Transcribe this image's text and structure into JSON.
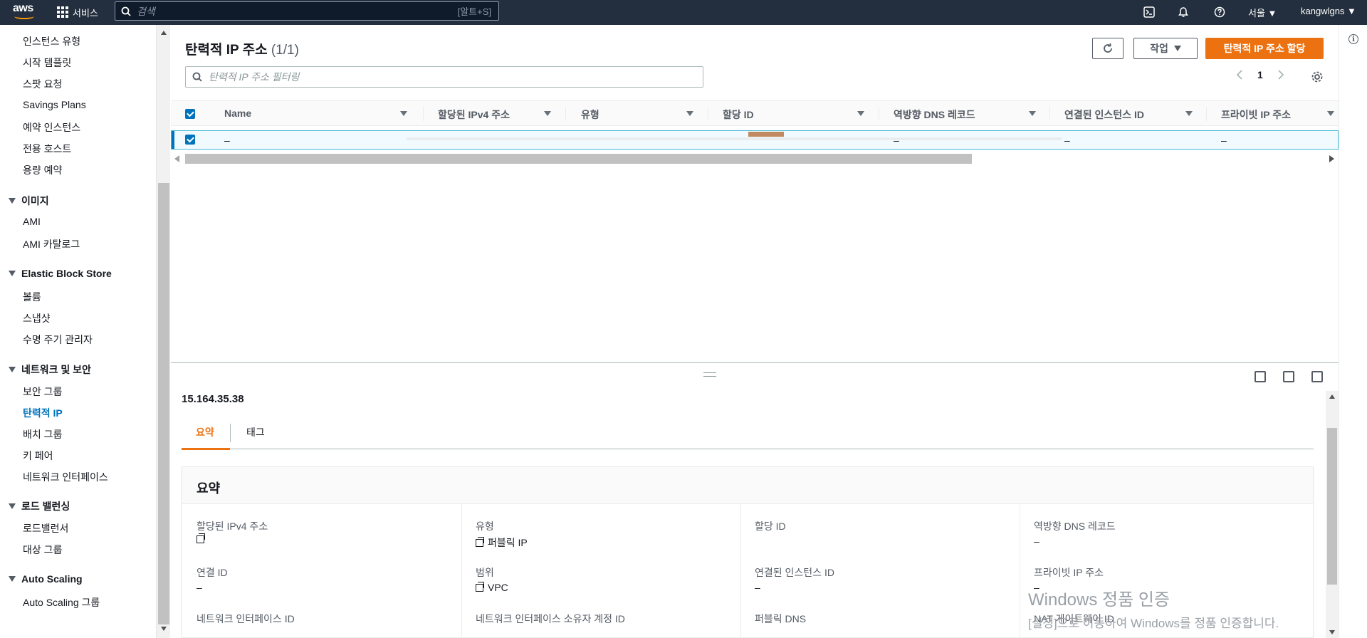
{
  "topnav": {
    "logo_text": "aws",
    "services_label": "서비스",
    "search_placeholder": "검색",
    "search_shortcut": "[알트+S]",
    "region": "서울 ▼",
    "account": "kangwlgns ▼"
  },
  "sidebar": {
    "items_top": [
      "인스턴스 유형",
      "시작 템플릿",
      "스팟 요청",
      "Savings Plans",
      "예약 인스턴스",
      "전용 호스트",
      "용량 예약"
    ],
    "section_images": {
      "title": "이미지",
      "items": [
        "AMI",
        "AMI 카탈로그"
      ]
    },
    "section_ebs": {
      "title": "Elastic Block Store",
      "items": [
        "볼륨",
        "스냅샷",
        "수명 주기 관리자"
      ]
    },
    "section_network": {
      "title": "네트워크 및 보안",
      "items": [
        "보안 그룹",
        "탄력적 IP",
        "배치 그룹",
        "키 페어",
        "네트워크 인터페이스"
      ],
      "active": "탄력적 IP"
    },
    "section_lb": {
      "title": "로드 밸런싱",
      "items": [
        "로드밸런서",
        "대상 그룹"
      ]
    },
    "section_as": {
      "title": "Auto Scaling",
      "items": [
        "Auto Scaling 그룹"
      ]
    }
  },
  "main": {
    "title": "탄력적 IP 주소",
    "count": "(1/1)",
    "actions_label": "작업",
    "allocate_label": "탄력적 IP 주소 할당",
    "filter_placeholder": "탄력적 IP 주소 필터링",
    "page_number": "1"
  },
  "table": {
    "columns": [
      "Name",
      "할당된 IPv4 주소",
      "유형",
      "할당 ID",
      "역방향 DNS 레코드",
      "연결된 인스턴스 ID",
      "프라이빗 IP 주소"
    ],
    "rows": [
      {
        "name": "–",
        "ipv4": "",
        "type": "",
        "allocation_id": "",
        "reverse_dns": "–",
        "instance_id": "–",
        "private_ip": "–",
        "selected": true
      }
    ]
  },
  "detail": {
    "title": "15.164.35.38",
    "tabs": [
      "요약",
      "태그"
    ],
    "active_tab": "요약",
    "summary_title": "요약",
    "fields": [
      {
        "label": "할당된 IPv4 주소",
        "value": ""
      },
      {
        "label": "유형",
        "value": "퍼블릭 IP"
      },
      {
        "label": "할당 ID",
        "value": ""
      },
      {
        "label": "역방향 DNS 레코드",
        "value": "–"
      },
      {
        "label": "연결 ID",
        "value": "–"
      },
      {
        "label": "범위",
        "value": "VPC"
      },
      {
        "label": "연결된 인스턴스 ID",
        "value": "–"
      },
      {
        "label": "프라이빗 IP 주소",
        "value": "–"
      },
      {
        "label": "네트워크 인터페이스 ID",
        "value": ""
      },
      {
        "label": "네트워크 인터페이스 소유자 계정 ID",
        "value": ""
      },
      {
        "label": "퍼블릭 DNS",
        "value": ""
      },
      {
        "label": "NAT 게이트웨이 ID",
        "value": ""
      }
    ]
  },
  "watermark": {
    "line1": "Windows 정품 인증",
    "line2": "[설정]으로 이동하여 Windows를 정품 인증합니다."
  },
  "colors": {
    "nav_bg": "#232f3e",
    "primary_button": "#ec7211",
    "link_active": "#0073bb",
    "selection_border": "#44b9d6"
  }
}
